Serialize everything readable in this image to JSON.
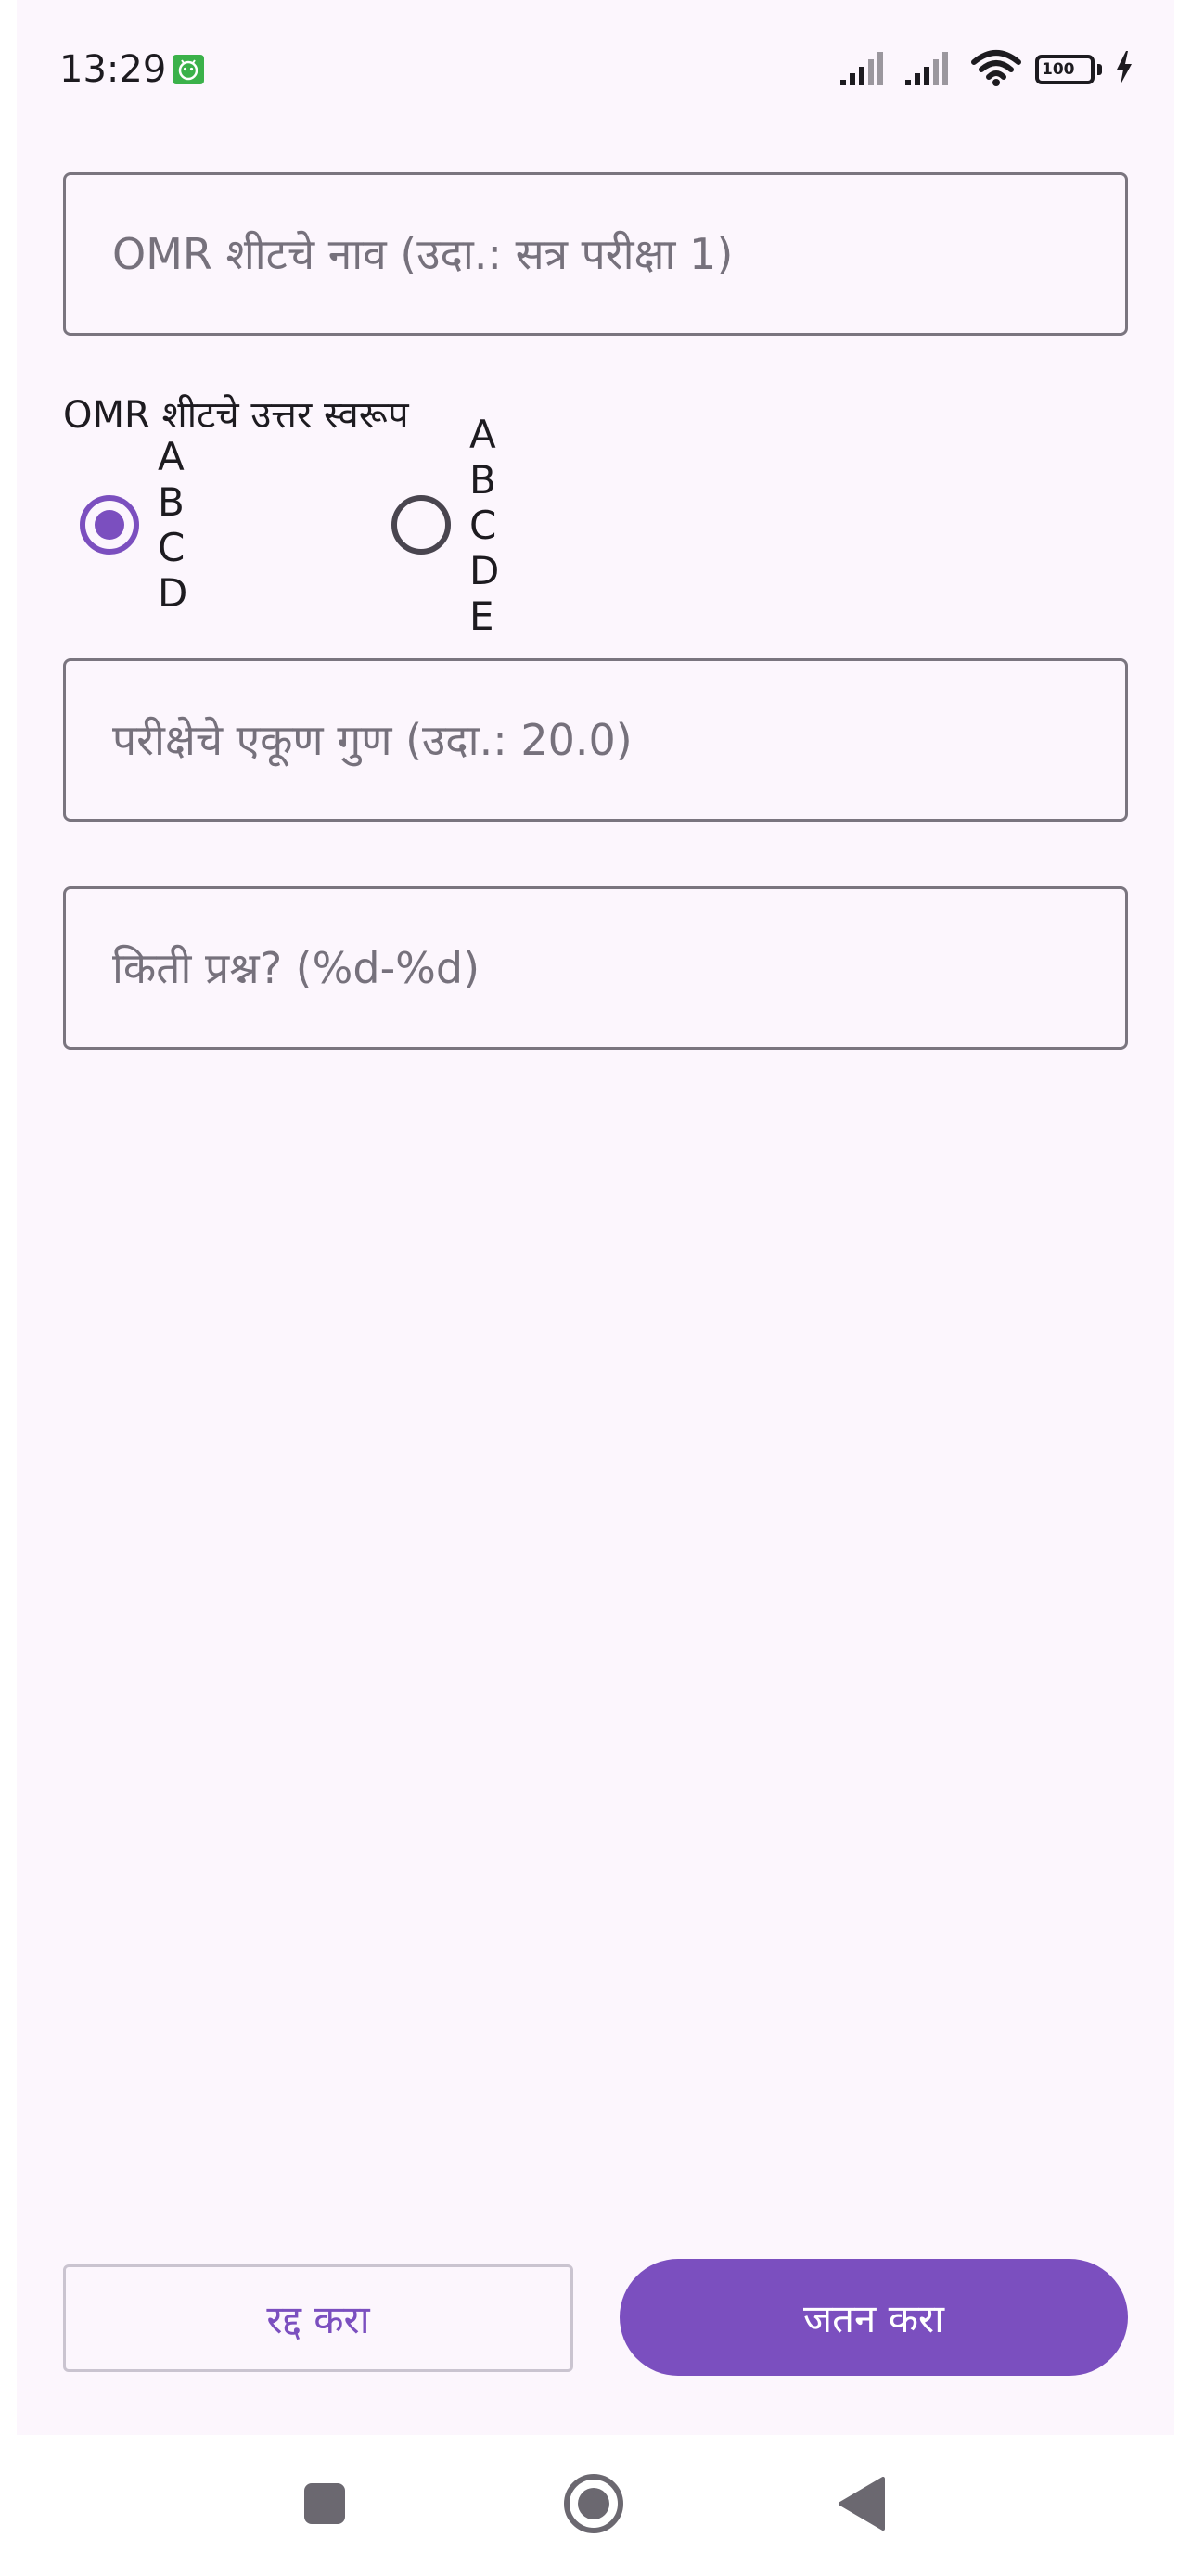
{
  "status_bar": {
    "time": "13:29",
    "battery_level": "100",
    "icons": [
      "app-notification-icon",
      "signal-icon",
      "signal-icon",
      "wifi-icon",
      "battery-icon",
      "charging-icon"
    ]
  },
  "form": {
    "sheet_name": {
      "value": "",
      "placeholder": "OMR शीटचे नाव (उदा.: सत्र परीक्षा 1)"
    },
    "answer_format": {
      "label": "OMR शीटचे उत्तर स्वरूप",
      "options": [
        {
          "label": "A B C D",
          "selected": true
        },
        {
          "label": "A B C D E",
          "selected": false
        }
      ]
    },
    "total_marks": {
      "value": "",
      "placeholder": "परीक्षेचे एकूण गुण (उदा.: 20.0)"
    },
    "question_count": {
      "value": "",
      "placeholder": "किती प्रश्न? (%d-%d)"
    }
  },
  "actions": {
    "cancel_label": "रद्द करा",
    "save_label": "जतन करा"
  },
  "navigation": {
    "items": [
      "recents-button",
      "home-button",
      "back-button"
    ]
  },
  "colors": {
    "primary": "#7b4fbf",
    "background": "#fcf6fd",
    "outline": "#7a757f",
    "battery": "#6abf2e"
  }
}
